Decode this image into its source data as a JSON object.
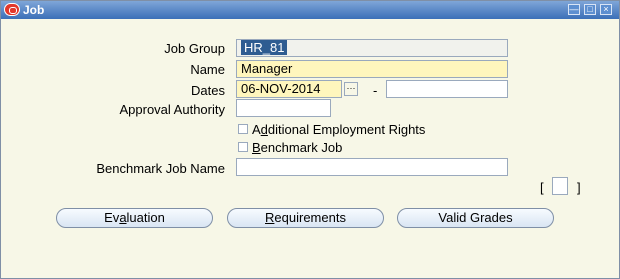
{
  "window": {
    "title": "Job"
  },
  "form": {
    "job_group": {
      "label": "Job Group",
      "value": "HR_81"
    },
    "name": {
      "label": "Name",
      "value": "Manager"
    },
    "dates": {
      "label": "Dates",
      "from_value": "06-NOV-2014",
      "separator": "-",
      "to_value": ""
    },
    "approval_authority": {
      "label": "Approval Authority",
      "value": ""
    },
    "additional_employment_rights": {
      "label_prefix": "A",
      "label_accel": "d",
      "label_rest": "ditional Employment Rights",
      "checked": false
    },
    "benchmark_job": {
      "label_accel": "B",
      "label_rest": "enchmark Job",
      "checked": false
    },
    "benchmark_job_name": {
      "label": "Benchmark Job Name",
      "value": ""
    },
    "descriptive_flex": {
      "open": "[",
      "close": "]"
    }
  },
  "buttons": {
    "evaluation": {
      "prefix": "Ev",
      "accel": "a",
      "rest": "luation"
    },
    "requirements": {
      "accel": "R",
      "rest": "equirements"
    },
    "valid_grades": {
      "label": "Valid Grades"
    }
  },
  "icons": {
    "lov": "ellipsis-icon"
  }
}
